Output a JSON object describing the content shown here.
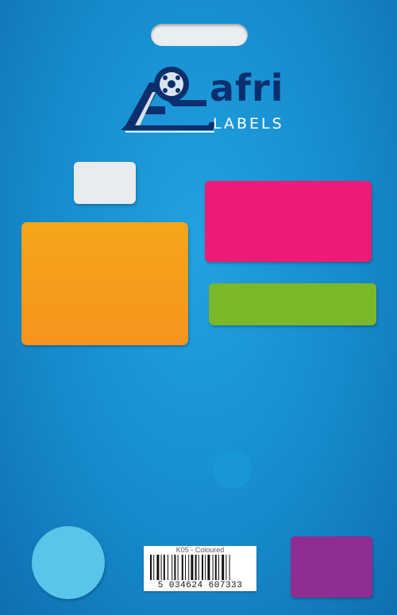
{
  "brand": {
    "name": "afri",
    "product_line": "LABELS",
    "icon": "label-roll-icon"
  },
  "samples": [
    {
      "name": "white-label",
      "color": "#e9ecef"
    },
    {
      "name": "pink-label",
      "color": "#ec1b78"
    },
    {
      "name": "orange-label",
      "color": "#f7941d"
    },
    {
      "name": "green-label",
      "color": "#7ab829"
    },
    {
      "name": "light-blue-dot",
      "color": "#57c6ea"
    },
    {
      "name": "blue-dot",
      "color": "#1796d8"
    },
    {
      "name": "purple-label",
      "color": "#8e2d92"
    }
  ],
  "barcode": {
    "code_text": "K05 - Coloured",
    "number": "5 034624 607333"
  },
  "colors": {
    "background": "#1a8fd0",
    "brand_navy": "#0b2f6e"
  }
}
